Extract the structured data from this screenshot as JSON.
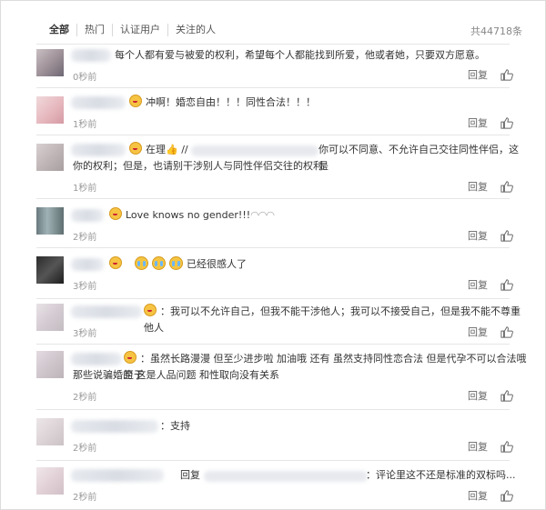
{
  "tabs": [
    "全部",
    "热门",
    "认证用户",
    "关注的人"
  ],
  "total": "共44718条",
  "reply_label": "回复",
  "comments": [
    {
      "text": "每个人都有爱与被爱的权利，希望每个人都能找到所爱，他或者她，只要双方愿意。",
      "time": "0秒前"
    },
    {
      "text": "冲啊！婚恋自由！！！同性合法！！！",
      "time": "1秒前"
    },
    {
      "text": "在理👍 //",
      "text2": "你可以不同意、不允许自己交往同性伴侣，这是",
      "text3": "你的权利；但是，也请别干涉别人与同性伴侣交往的权利。",
      "time": "1秒前"
    },
    {
      "text": "Love knows no gender!!!",
      "time": "2秒前"
    },
    {
      "text": "已经很感人了",
      "time": "3秒前"
    },
    {
      "text": "：我可以不允许自己，但我不能干涉他人；我可以不接受自己，但是我不能不尊重他人",
      "time": "3秒前"
    },
    {
      "text": "：虽然长路漫漫 但至少进步啦 加油哦 还有 虽然支持同性恋合法 但是代孕不可以合法哦 至于",
      "text2": "那些说骗婚的 这是人品问题 和性取向没有关系",
      "time": "2秒前"
    },
    {
      "text": "：支持",
      "time": "2秒前"
    },
    {
      "text": "回复",
      "text2": "：评论里这不还是标准的双标吗...",
      "time": "2秒前"
    }
  ]
}
